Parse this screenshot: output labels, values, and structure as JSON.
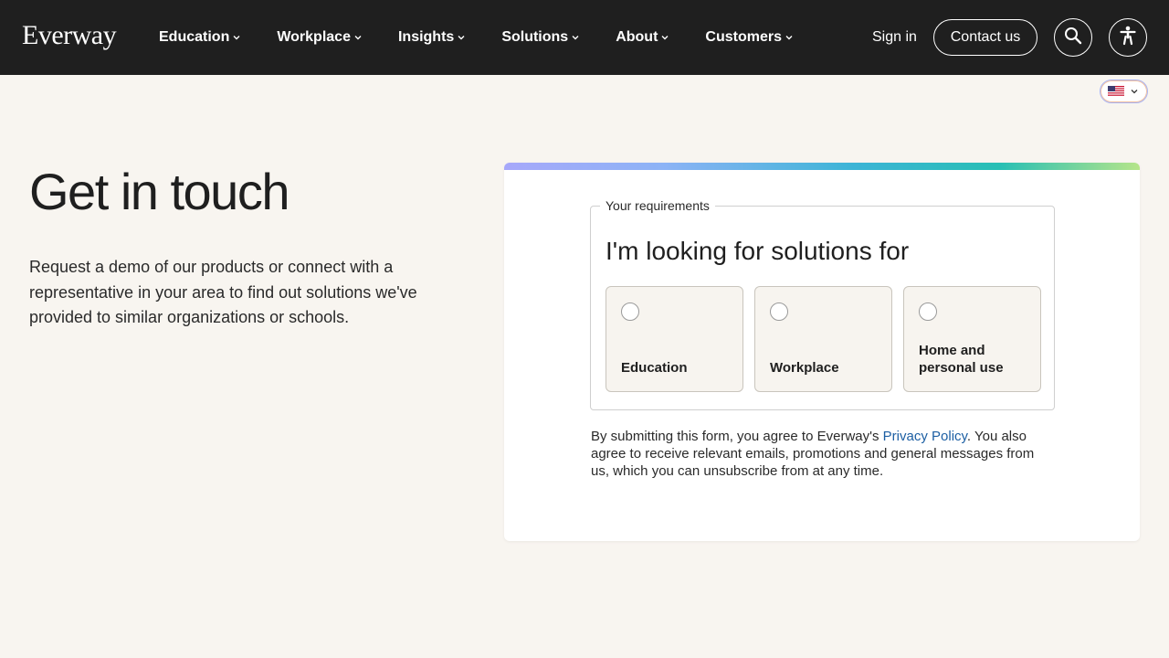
{
  "header": {
    "logo": "Everway",
    "nav": [
      {
        "label": "Education"
      },
      {
        "label": "Workplace"
      },
      {
        "label": "Insights"
      },
      {
        "label": "Solutions"
      },
      {
        "label": "About"
      },
      {
        "label": "Customers"
      }
    ],
    "sign_in": "Sign in",
    "contact": "Contact us",
    "search_icon": "search-icon",
    "accessibility_icon": "accessibility-icon"
  },
  "locale": {
    "flag": "us-flag-icon",
    "chevron": "chevron-down-icon"
  },
  "hero": {
    "title": "Get in touch",
    "intro": "Request a demo of our products or connect with a representative in your area to find out solutions we've provided to similar organizations or schools."
  },
  "form": {
    "legend": "Your requirements",
    "question": "I'm looking for solutions for",
    "options": [
      {
        "label": "Education"
      },
      {
        "label": "Workplace"
      },
      {
        "label": "Home and personal use"
      }
    ],
    "consent_before": "By submitting this form, you agree to Everway's ",
    "consent_link": "Privacy Policy",
    "consent_after": ". You also agree to receive relevant emails, promotions and general messages from us, which you can unsubscribe from at any time."
  },
  "colors": {
    "header_bg": "#1f1f1f",
    "page_bg": "#f8f5f0",
    "link": "#1d5fa3"
  }
}
